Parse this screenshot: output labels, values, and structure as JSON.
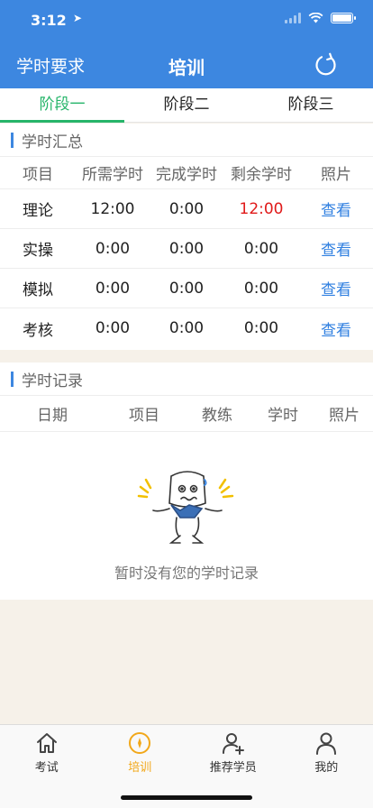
{
  "status": {
    "time": "3:12"
  },
  "nav": {
    "left_label": "学时要求",
    "title": "培训"
  },
  "tabs": [
    {
      "label": "阶段一",
      "active": true
    },
    {
      "label": "阶段二",
      "active": false
    },
    {
      "label": "阶段三",
      "active": false
    }
  ],
  "summary": {
    "title": "学时汇总",
    "headers": [
      "项目",
      "所需学时",
      "完成学时",
      "剩余学时",
      "照片"
    ],
    "rows": [
      {
        "item": "理论",
        "required": "12:00",
        "done": "0:00",
        "remaining": "12:00",
        "photo": "查看"
      },
      {
        "item": "实操",
        "required": "0:00",
        "done": "0:00",
        "remaining": "0:00",
        "photo": "查看"
      },
      {
        "item": "模拟",
        "required": "0:00",
        "done": "0:00",
        "remaining": "0:00",
        "photo": "查看"
      },
      {
        "item": "考核",
        "required": "0:00",
        "done": "0:00",
        "remaining": "0:00",
        "photo": "查看"
      }
    ]
  },
  "records": {
    "title": "学时记录",
    "headers": [
      "日期",
      "项目",
      "教练",
      "学时",
      "照片"
    ],
    "empty_text": "暂时没有您的学时记录"
  },
  "tabbar": [
    {
      "label": "考试",
      "icon": "home-icon",
      "active": false
    },
    {
      "label": "培训",
      "icon": "compass-icon",
      "active": true
    },
    {
      "label": "推荐学员",
      "icon": "add-user-icon",
      "active": false
    },
    {
      "label": "我的",
      "icon": "user-icon",
      "active": false
    }
  ],
  "colors": {
    "primary": "#3d87e0",
    "tab_active": "#26b56a",
    "alert": "#e01a1a",
    "link": "#2f7fe0",
    "tabbar_active": "#f2a81a"
  }
}
